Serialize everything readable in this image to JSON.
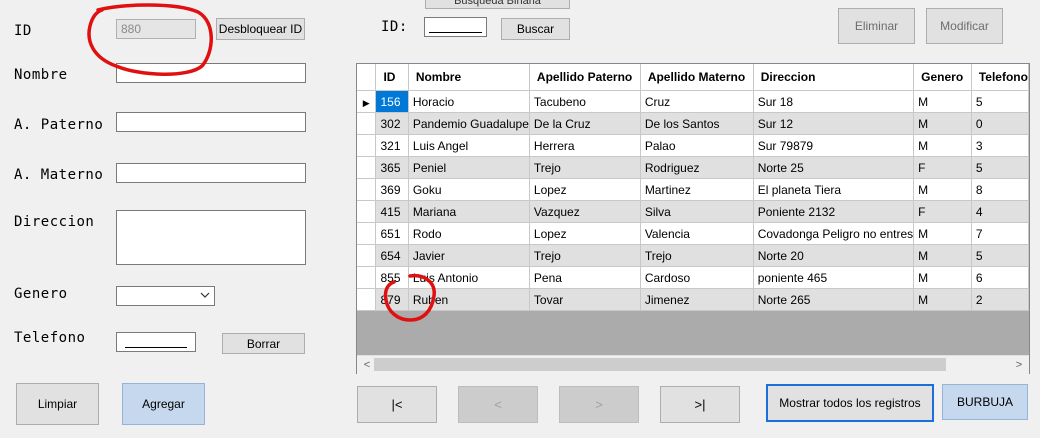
{
  "form": {
    "id_label": "ID",
    "id_value": "880",
    "unlock_button": "Desbloquear ID",
    "nombre_label": "Nombre",
    "paterno_label": "A. Paterno",
    "materno_label": "A. Materno",
    "direccion_label": "Direccion",
    "genero_label": "Genero",
    "telefono_label": "Telefono",
    "borrar_button": "Borrar",
    "limpiar_button": "Limpiar",
    "agregar_button": "Agregar"
  },
  "search": {
    "top_button": "Busqueda Binaria",
    "id_label": "ID:",
    "buscar_button": "Buscar"
  },
  "actions": {
    "eliminar": "Eliminar",
    "modificar": "Modificar"
  },
  "nav": {
    "first": "|<",
    "prev": "<",
    "next": ">",
    "last": ">|",
    "show_all": "Mostrar todos los registros",
    "bubble": "BURBUJA"
  },
  "grid": {
    "columns": [
      "ID",
      "Nombre",
      "Apellido Paterno",
      "Apellido Materno",
      "Direccion",
      "Genero",
      "Telefono"
    ],
    "rows": [
      [
        "156",
        "Horacio",
        "Tacubeno",
        "Cruz",
        "Sur 18",
        "M",
        "5"
      ],
      [
        "302",
        "Pandemio Guadalupe",
        "De la Cruz",
        "De los Santos",
        "Sur 12",
        "M",
        "0"
      ],
      [
        "321",
        "Luis Angel",
        "Herrera",
        "Palao",
        "Sur 79879",
        "M",
        "3"
      ],
      [
        "365",
        "Peniel",
        "Trejo",
        "Rodriguez",
        "Norte 25",
        "F",
        "5"
      ],
      [
        "369",
        "Goku",
        "Lopez",
        "Martinez",
        "El planeta Tiera",
        "M",
        "8"
      ],
      [
        "415",
        "Mariana",
        "Vazquez",
        "Silva",
        "Poniente 2132",
        "F",
        "4"
      ],
      [
        "651",
        "Rodo",
        "Lopez",
        "Valencia",
        "Covadonga Peligro no entres",
        "M",
        "7"
      ],
      [
        "654",
        "Javier",
        "Trejo",
        "Trejo",
        "Norte 20",
        "M",
        "5"
      ],
      [
        "855",
        "Luis Antonio",
        "Pena",
        "Cardoso",
        "poniente 465",
        "M",
        "6"
      ],
      [
        "879",
        "Ruben",
        "Tovar",
        "Jimenez",
        "Norte 265",
        "M",
        "2"
      ]
    ],
    "row_indicator": "▶",
    "scroll_left": "<",
    "scroll_right": ">"
  },
  "icons": {
    "dropdown": "chevron-down-icon",
    "row_pointer": "row-pointer-icon"
  },
  "colors": {
    "selected_cell": "#0078d7",
    "annotation_red": "#e01010",
    "primary_button": "#c6d8ee"
  }
}
